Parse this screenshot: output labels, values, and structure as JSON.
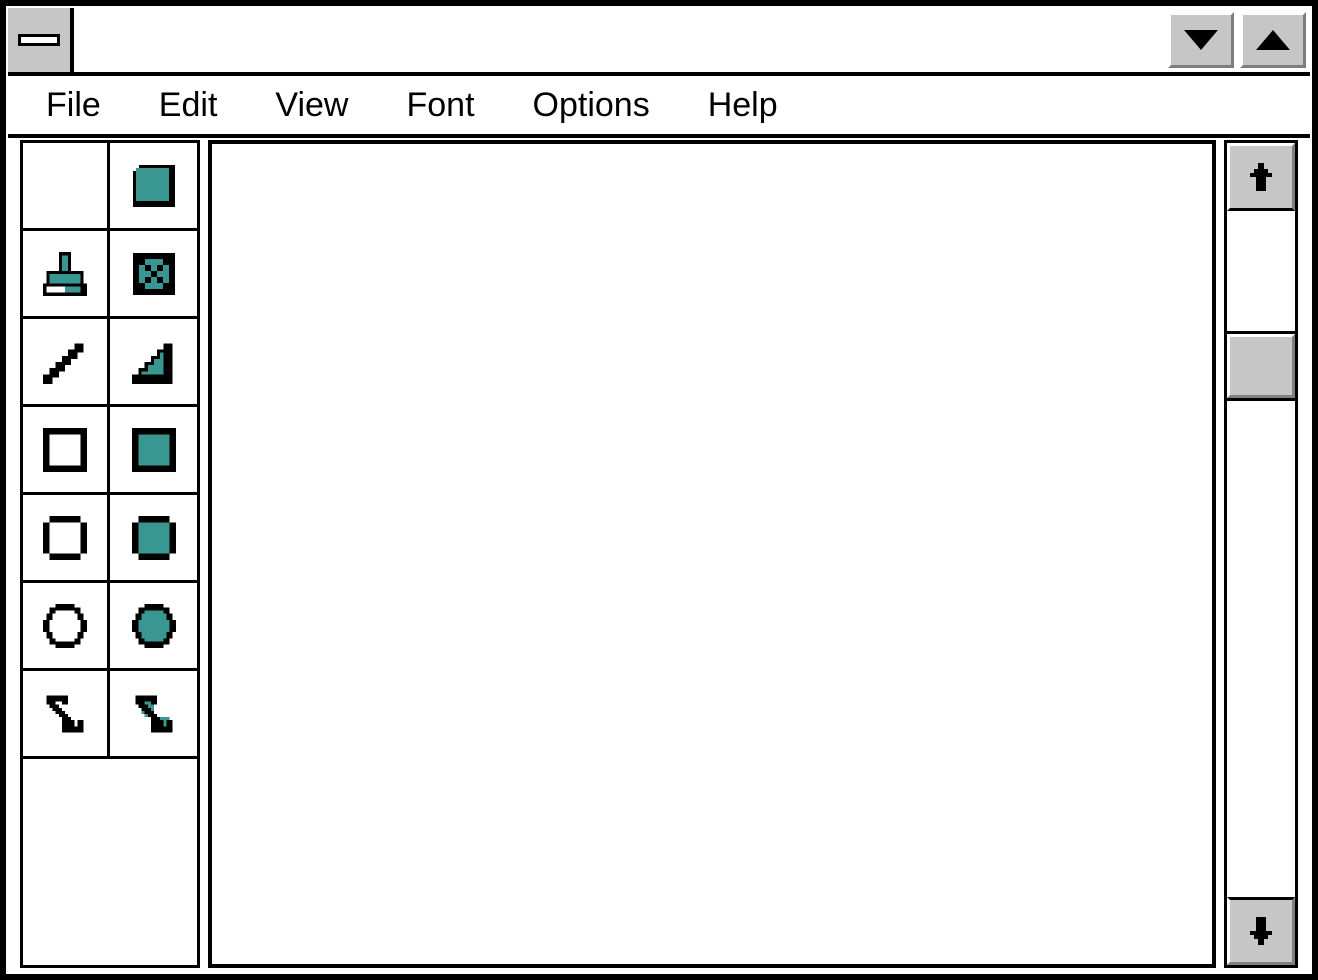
{
  "window": {
    "title": "",
    "title_placeholder": "",
    "frame_color": "#000000",
    "face_color": "#c6c6c6",
    "accent_color": "#3a9690"
  },
  "titlebar": {
    "system_menu_icon": "minimize-bar-icon",
    "buttons": [
      {
        "name": "minimize-button",
        "icon": "triangle-down-icon",
        "label": "Minimize"
      },
      {
        "name": "maximize-button",
        "icon": "triangle-up-icon",
        "label": "Maximize"
      }
    ]
  },
  "menubar": {
    "items": [
      {
        "label": "File"
      },
      {
        "label": "Edit"
      },
      {
        "label": "View"
      },
      {
        "label": "Font"
      },
      {
        "label": "Options"
      },
      {
        "label": "Help"
      }
    ]
  },
  "toolbox": {
    "tools": [
      {
        "name": "tool-blank",
        "icon": "blank-icon",
        "label": "Blank"
      },
      {
        "name": "tool-filled-square",
        "icon": "filled-square-icon",
        "label": "Filled Square"
      },
      {
        "name": "tool-stamp",
        "icon": "stamp-icon",
        "label": "Stamp"
      },
      {
        "name": "tool-select-box",
        "icon": "crossed-box-icon",
        "label": "Select Box"
      },
      {
        "name": "tool-line",
        "icon": "line-icon",
        "label": "Line"
      },
      {
        "name": "tool-filled-triangle",
        "icon": "filled-triangle-icon",
        "label": "Filled Triangle"
      },
      {
        "name": "tool-rectangle-outline",
        "icon": "rectangle-outline-icon",
        "label": "Rectangle Outline"
      },
      {
        "name": "tool-rectangle-filled",
        "icon": "rectangle-filled-icon",
        "label": "Rectangle Filled"
      },
      {
        "name": "tool-rounded-rect-outline",
        "icon": "rounded-rect-outline-icon",
        "label": "Rounded Rectangle Outline"
      },
      {
        "name": "tool-rounded-rect-filled",
        "icon": "rounded-rect-filled-icon",
        "label": "Rounded Rectangle Filled"
      },
      {
        "name": "tool-ellipse-outline",
        "icon": "ellipse-outline-icon",
        "label": "Ellipse Outline"
      },
      {
        "name": "tool-ellipse-filled",
        "icon": "ellipse-filled-icon",
        "label": "Ellipse Filled"
      },
      {
        "name": "tool-polygon-outline",
        "icon": "polygon-outline-icon",
        "label": "Polygon Outline"
      },
      {
        "name": "tool-polygon-filled",
        "icon": "polygon-filled-icon",
        "label": "Polygon Filled"
      }
    ]
  },
  "canvas": {
    "content": "",
    "background": "#ffffff"
  },
  "scrollbar": {
    "up_icon": "arrow-up-icon",
    "down_icon": "arrow-down-icon",
    "thumb_position_percent": 18
  }
}
